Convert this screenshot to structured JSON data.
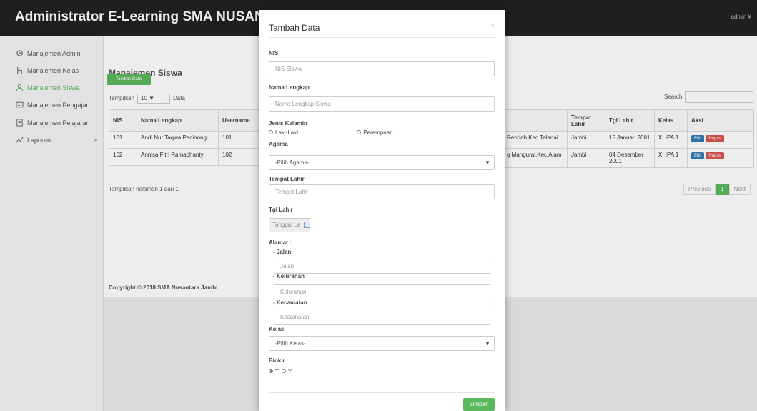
{
  "app": {
    "brand": "Administrator E-Learning SMA NUSANTARA JAMBI",
    "user": "admin ¥"
  },
  "sidebar": {
    "items": [
      {
        "label": "Manajemen Admin",
        "icon": "gear-icon"
      },
      {
        "label": "Manajemen Kelas",
        "icon": "chair-icon"
      },
      {
        "label": "Manajemen Siswa",
        "icon": "user-icon"
      },
      {
        "label": "Manajemen Pengajar",
        "icon": "id-card-icon"
      },
      {
        "label": "Manajemen Pelajaran",
        "icon": "book-icon"
      },
      {
        "label": "Laporan",
        "icon": "report-icon"
      }
    ],
    "caret": ">"
  },
  "main": {
    "title": "Manajemen Siswa",
    "add_button": "Tambah Data",
    "show_prefix": "Tampilkan",
    "show_value": "10",
    "show_suffix": "Data",
    "search_label": "Search:",
    "table": {
      "left_headers": [
        "NIS",
        "Nama Lengkap",
        "Username"
      ],
      "right_headers": [
        "Tempat Lahir",
        "Tgl Lahir",
        "Kelas",
        "Aksi"
      ],
      "rows": [
        {
          "nis": "101",
          "nama": "Andi Nur Taqwa Pacinongi",
          "username": "101",
          "alamat": "Rendah,Kec.Telanai",
          "tempat": "Jambi",
          "tgl": "15 Januari 2001",
          "kelas": "XI IPA 1"
        },
        {
          "nis": "102",
          "nama": "Annisa Fitri Ramadhanty",
          "username": "102",
          "alamat": "g Mangurai,Kec.Alam",
          "tempat": "Jambi",
          "tgl": "04 Desember 2001",
          "kelas": "XI IPA 1"
        }
      ],
      "edit": "Edit",
      "delete": "Hapus"
    },
    "page_info": "Tampilkan halaman 1 dari 1",
    "pager": {
      "prev": "Previous",
      "current": "1",
      "next": "Next"
    },
    "copyright": "Copyright © 2018 SMA Nusantara Jambi"
  },
  "modal": {
    "title": "Tambah Data",
    "close": "×",
    "nis_label": "NIS",
    "nis_placeholder": "NIS Siswa",
    "nama_label": "Nama Lengkap",
    "nama_placeholder": "Nama Lengkap Siswa",
    "jk_label": "Jenis Kelamin",
    "jk_opt1": "Laki-Laki",
    "jk_opt2": "Perempuan",
    "agama_label": "Agama",
    "agama_value": "-Pilih Agama-",
    "tempat_label": "Tempat Lahir",
    "tempat_placeholder": "Tempat Lahir",
    "tgl_label": "Tgl Lahir",
    "tgl_placeholder": "Tanggal La",
    "alamat_label": "Alamat :",
    "jalan_label": "- Jalan",
    "jalan_placeholder": "Jalan",
    "kelurahan_label": "- Kelurahan",
    "kelurahan_placeholder": "Kelurahan",
    "kecamatan_label": "- Kecamatan",
    "kecamatan_placeholder": "Kecamatan",
    "kelas_label": "Kelas",
    "kelas_value": "-Pilih Kelas-",
    "blokir_label": "Blokir",
    "blokir_t": "T",
    "blokir_y": "Y",
    "save": "Simpan"
  },
  "colors": {
    "navbar": "#222222",
    "accent_green": "#5cb85c",
    "edit_blue": "#337ab7",
    "delete_red": "#d9534f"
  }
}
